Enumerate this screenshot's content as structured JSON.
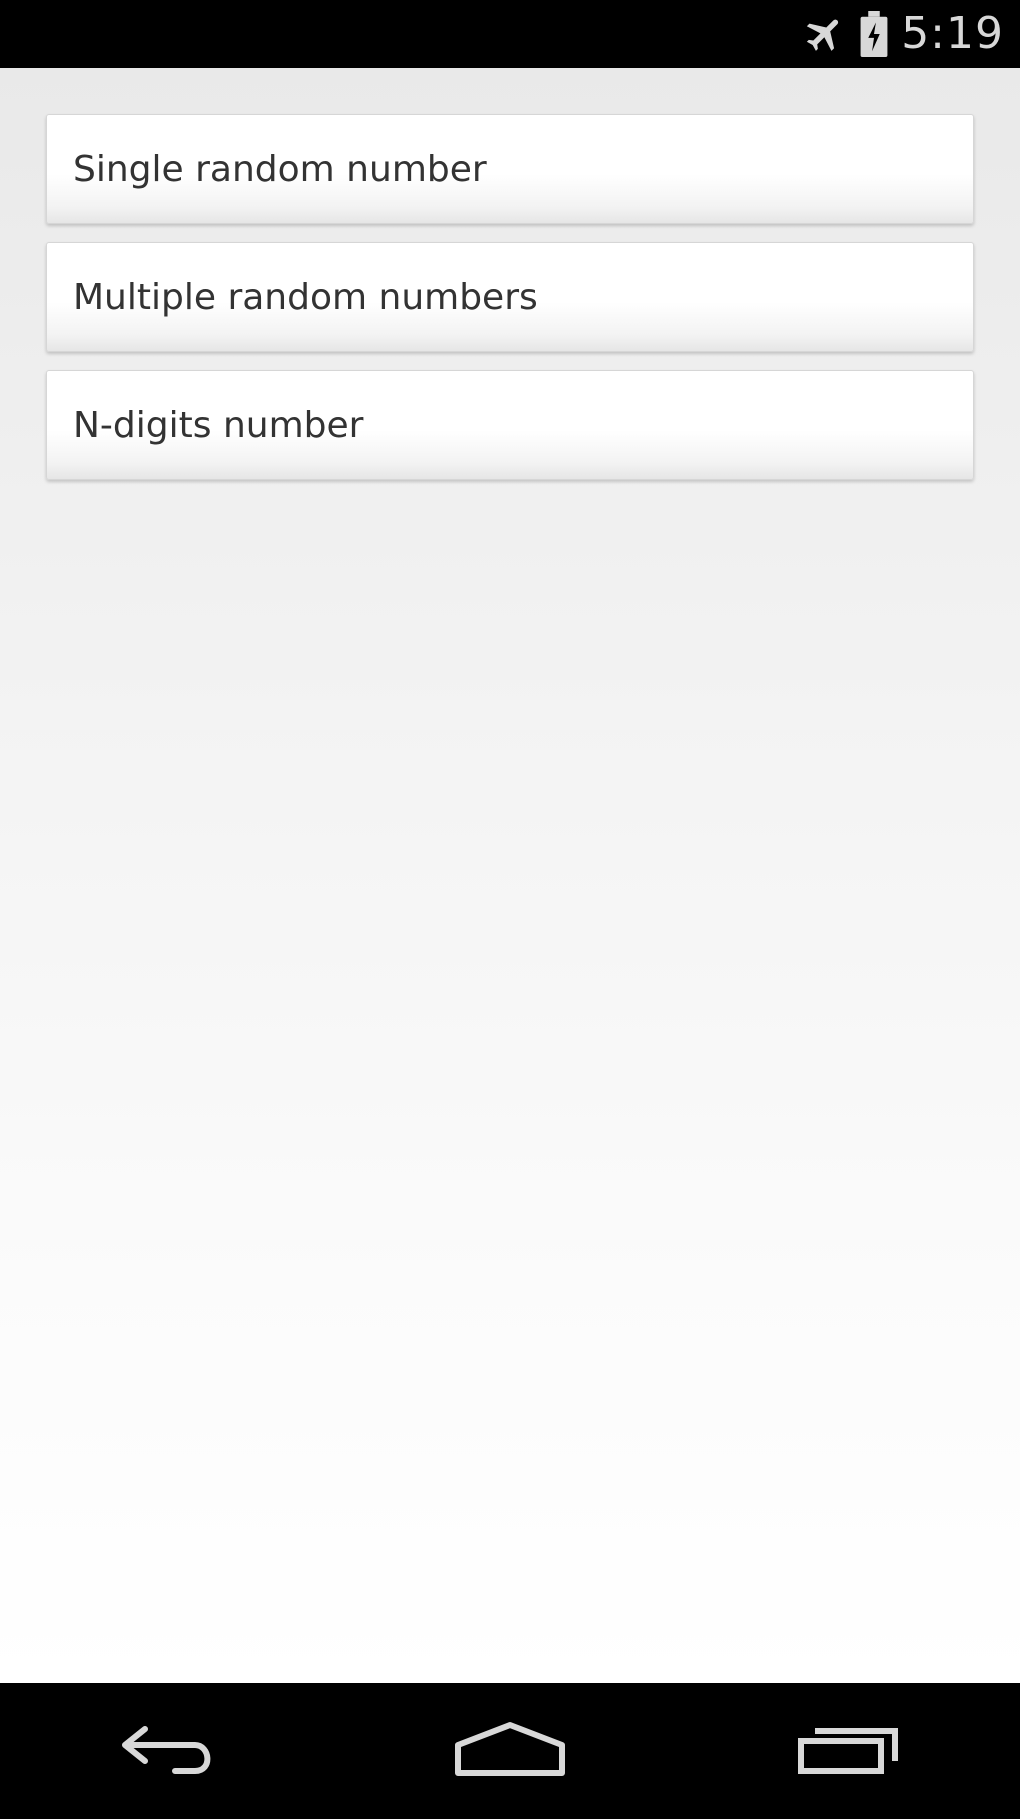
{
  "status_bar": {
    "time": "5:19",
    "icons": [
      "airplane-mode-icon",
      "battery-charging-icon"
    ]
  },
  "menu": {
    "items": [
      {
        "label": "Single random number"
      },
      {
        "label": "Multiple random numbers"
      },
      {
        "label": "N-digits number"
      }
    ]
  },
  "nav_bar": {
    "buttons": [
      "back-icon",
      "home-icon",
      "recent-apps-icon"
    ]
  },
  "colors": {
    "system_bar": "#000000",
    "icon": "#d8d8d8",
    "button_text": "#333333"
  }
}
